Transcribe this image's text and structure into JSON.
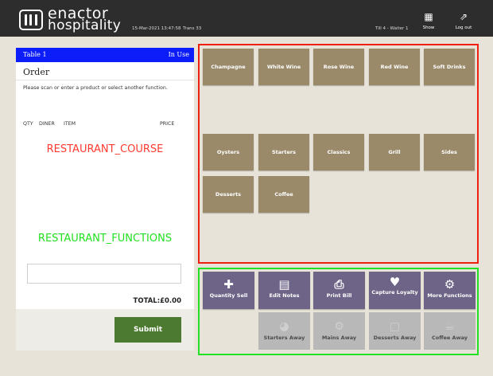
{
  "header": {
    "brand_line1": "enactor",
    "brand_line2": "hospitality",
    "datetime": "15-Mar-2021 13:47:58",
    "trans": "Trans 33",
    "till": "Till 4 - Waiter 1",
    "show_label": "Show",
    "logout_label": "Log out"
  },
  "order": {
    "table_name": "Table 1",
    "table_status": "In Use",
    "title": "Order",
    "instruction": "Please scan or enter a product or select another function.",
    "col_qty": "QTY",
    "col_diner": "DINER",
    "col_item": "ITEM",
    "col_price": "PRICE",
    "course_placeholder": "RESTAURANT_COURSE",
    "functions_placeholder": "RESTAURANT_FUNCTIONS",
    "scan_value": "",
    "total": "TOTAL:£0.00",
    "submit_label": "Submit"
  },
  "products": [
    {
      "label": "Champagne"
    },
    {
      "label": "White Wine"
    },
    {
      "label": "Rose Wine"
    },
    {
      "label": "Red Wine"
    },
    {
      "label": "Soft Drinks"
    },
    {
      "label": "Oysters"
    },
    {
      "label": "Starters"
    },
    {
      "label": "Classics"
    },
    {
      "label": "Grill"
    },
    {
      "label": "Sides"
    },
    {
      "label": "Desserts"
    },
    {
      "label": "Coffee"
    }
  ],
  "functions": [
    {
      "label": "Quantity Sell",
      "icon": "plus-icon"
    },
    {
      "label": "Edit Notes",
      "icon": "note-icon"
    },
    {
      "label": "Print Bill",
      "icon": "printer-icon"
    },
    {
      "label": "Capture Loyalty",
      "icon": "heart-icon"
    },
    {
      "label": "More Functions",
      "icon": "gears-icon"
    }
  ],
  "course_actions": [
    {
      "label": "Starters Away",
      "icon": "bowl-icon"
    },
    {
      "label": "Mains Away",
      "icon": "cutlery-icon"
    },
    {
      "label": "Desserts Away",
      "icon": "cake-icon"
    },
    {
      "label": "Coffee Away",
      "icon": "coffee-cup-icon"
    }
  ],
  "colors": {
    "product_button": "#9a8a6a",
    "function_button": "#6d6487",
    "course_button": "#b9b8b8",
    "table_bar": "#0d1dfa",
    "submit": "#4d7a31",
    "product_area_border": "#f02010",
    "function_area_border": "#22e022"
  }
}
